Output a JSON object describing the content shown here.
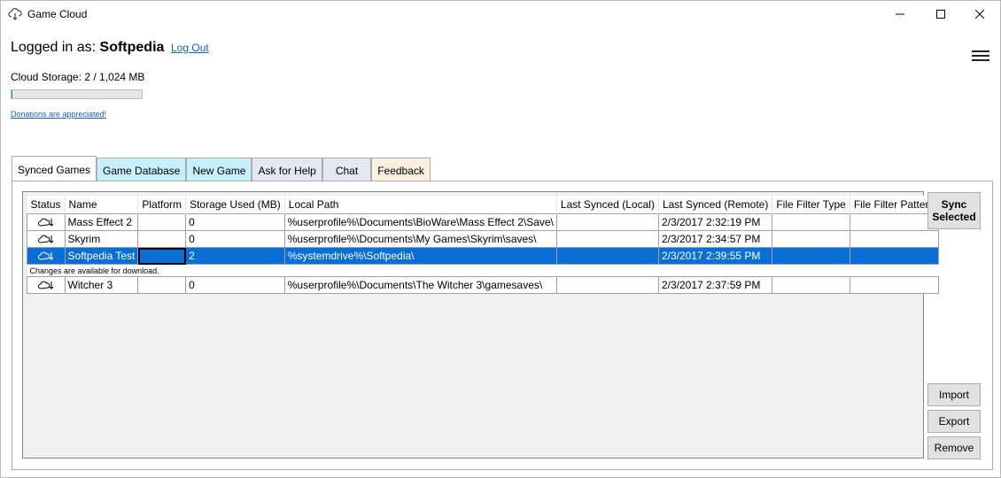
{
  "window": {
    "title": "Game Cloud"
  },
  "account": {
    "logged_in_prefix": "Logged in as:",
    "username": "Softpedia",
    "logout_label": "Log Out"
  },
  "storage": {
    "label": "Cloud Storage: 2 / 1,024 MB",
    "used_fraction": 0.002
  },
  "donate_link": "Donations are appreciated!",
  "tabs": [
    "Synced Games",
    "Game Database",
    "New Game",
    "Ask for Help",
    "Chat",
    "Feedback"
  ],
  "tab_colors": [
    "#ffffff",
    "#c8f1ff",
    "#c8f1ff",
    "#e4e8f2",
    "#e4e8f2",
    "#fdf0e0"
  ],
  "table": {
    "columns": [
      "Status",
      "Name",
      "Platform",
      "Storage Used (MB)",
      "Local Path",
      "Last Synced (Local)",
      "Last Synced (Remote)",
      "File Filter Type",
      "File Filter Pattern"
    ],
    "rows": [
      {
        "name": "Mass Effect 2",
        "platform": "",
        "storage": "0",
        "path": "%userprofile%\\Documents\\BioWare\\Mass Effect 2\\Save\\",
        "local": "",
        "remote": "2/3/2017 2:32:19 PM",
        "ftype": "",
        "fpattern": ""
      },
      {
        "name": "Skyrim",
        "platform": "",
        "storage": "0",
        "path": "%userprofile%\\Documents\\My Games\\Skyrim\\saves\\",
        "local": "",
        "remote": "2/3/2017 2:34:57 PM",
        "ftype": "",
        "fpattern": ""
      },
      {
        "name": "Softpedia Test",
        "platform": "",
        "storage": "2",
        "path": "%systemdrive%\\Softpedia\\",
        "local": "",
        "remote": "2/3/2017 2:39:55 PM",
        "ftype": "",
        "fpattern": ""
      },
      {
        "name": "Witcher 3",
        "platform": "",
        "storage": "0",
        "path": "%userprofile%\\Documents\\The Witcher 3\\gamesaves\\",
        "local": "",
        "remote": "2/3/2017 2:37:59 PM",
        "ftype": "",
        "fpattern": ""
      }
    ],
    "detail_text": "Changes are available for download."
  },
  "buttons": {
    "sync_selected": "Sync Selected",
    "import": "Import",
    "export": "Export",
    "remove": "Remove"
  },
  "icons": {
    "status": "cloud-download-icon"
  }
}
